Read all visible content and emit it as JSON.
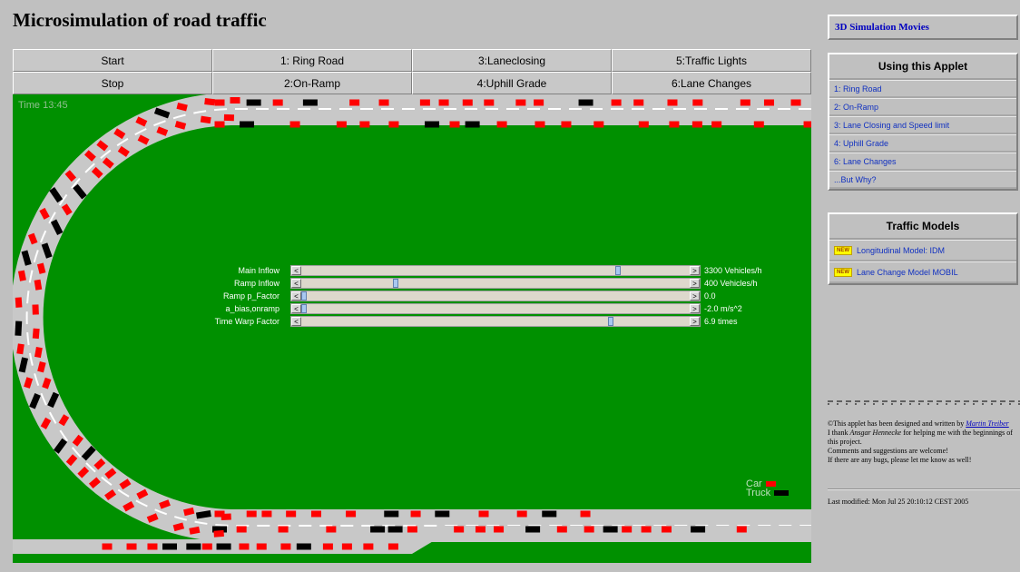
{
  "title": "Microsimulation of road traffic",
  "buttons": [
    [
      "Start",
      "1: Ring Road",
      "3:Laneclosing",
      "5:Traffic Lights"
    ],
    [
      "Stop",
      "2:On-Ramp",
      "4:Uphill Grade",
      "6:Lane Changes"
    ]
  ],
  "simulation": {
    "time_label": "Time  13:45",
    "controls": [
      {
        "label": "Main Inflow",
        "value_text": "3300 Vehicles/h",
        "position": 0.82
      },
      {
        "label": "Ramp Inflow",
        "value_text": "400 Vehicles/h",
        "position": 0.24
      },
      {
        "label": "Ramp p_Factor",
        "value_text": "0.0",
        "position": 0.0
      },
      {
        "label": "a_bias,onramp",
        "value_text": "-2.0 m/s^2",
        "position": 0.0
      },
      {
        "label": "Time Warp Factor",
        "value_text": "6.9 times",
        "position": 0.8
      }
    ],
    "legend": {
      "car": "Car",
      "truck": "Truck"
    },
    "colors": {
      "background": "#009000",
      "road": "#c8c8c8",
      "car": "#ff0000",
      "truck": "#000000"
    }
  },
  "sidebar": {
    "movies_link": "3D Simulation Movies",
    "using_title": "Using this Applet",
    "using_items": [
      "1: Ring Road",
      "2: On-Ramp",
      "3: Lane Closing and Speed limit",
      "4: Uphill Grade",
      "6: Lane Changes",
      "...But Why?"
    ],
    "models_title": "Traffic Models",
    "new_badge": "NEW",
    "model_items": [
      "Longitudinal Model: IDM",
      "Lane Change Model MOBIL"
    ],
    "credits": {
      "designed_prefix": "©This applet has been designed and written by ",
      "author": "Martin Treiber",
      "thanks_prefix": "I thank ",
      "helper": "Ansgar Hennecke",
      "thanks_suffix": " for helping me with the beginnings of this project.",
      "comments": "Comments and suggestions are welcome!",
      "bugs": "If there are any bugs, please let me know as well!"
    },
    "last_modified": "Last modified: Mon Jul 25 20:10:12 CEST 2005"
  }
}
